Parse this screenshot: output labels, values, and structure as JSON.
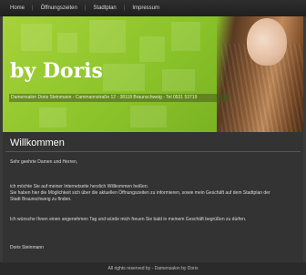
{
  "nav": {
    "items": [
      "Home",
      "Öffnungszeiten",
      "Stadtplan",
      "Impressum"
    ],
    "separator": "|"
  },
  "banner": {
    "logo": "by Doris",
    "address": "Damensalon Doris Steinmann - Cammannstraße 12 - 38118 Braunschweig - Tel 0531 53719"
  },
  "content": {
    "heading": "Willkommen",
    "greeting": "Sehr geehrte Damen und Herren,",
    "welcome": "ich möchte Sie auf meiner Internetseite herzlich Willkommen heißen.",
    "info_line1": "Sie haben hier die Möglichkeit sich über die aktuellen Öffnungszeiten zu informieren, sowie mein Geschäft auf dem Stadtplan der",
    "info_line2": "Stadt Braunschweig zu finden.",
    "wish": "Ich wünsche Ihnen einen angenehmen Tag und würde mich freuen Sie bald in meinem Geschäft begrüßen zu dürfen.",
    "signature": "Doris Steinmann"
  },
  "footer": {
    "text": "All rights reserved by - Damensalon by Doris"
  },
  "colors": {
    "banner_green": "#8cc42a",
    "background": "#3a3a3a",
    "nav_bg": "#2a2a2a"
  }
}
